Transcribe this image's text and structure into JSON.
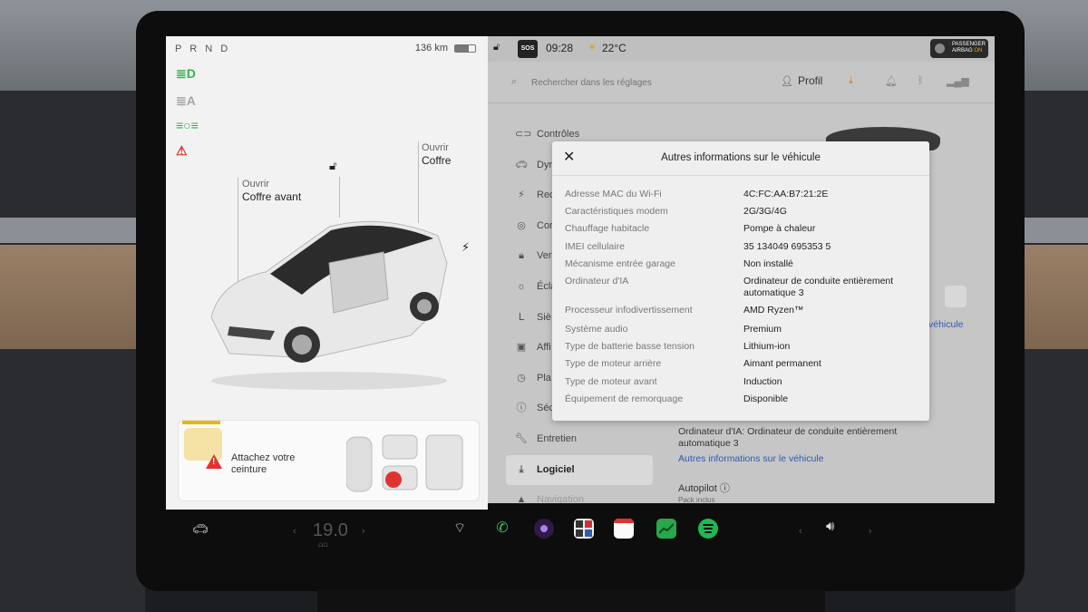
{
  "car": {
    "gear": "P R N D",
    "range": "136 km",
    "open_label_1": "Ouvrir",
    "coffre_avant": "Coffre avant",
    "open_label_2": "Ouvrir",
    "coffre": "Coffre",
    "belt_warning": "Attachez votre ceinture"
  },
  "status": {
    "sos": "SOS",
    "time": "09:28",
    "temperature": "22°C",
    "airbag_line1": "PASSENGER",
    "airbag_line2": "AIRBAG",
    "airbag_state": "ON"
  },
  "search": {
    "placeholder": "Rechercher dans les réglages",
    "profile": "Profil"
  },
  "menu": [
    {
      "label": "Contrôles",
      "icon": "toggle-icon"
    },
    {
      "label": "Dyn",
      "icon": "car-icon"
    },
    {
      "label": "Rec",
      "icon": "bolt-icon"
    },
    {
      "label": "Con",
      "icon": "steering-wheel-icon"
    },
    {
      "label": "Ver",
      "icon": "lock-icon"
    },
    {
      "label": "Écla",
      "icon": "light-icon"
    },
    {
      "label": "Siè",
      "icon": "seat-icon"
    },
    {
      "label": "Affi",
      "icon": "display-icon"
    },
    {
      "label": "Pla",
      "icon": "clock-icon"
    },
    {
      "label": "Séc",
      "icon": "info-icon"
    },
    {
      "label": "Entretien",
      "icon": "wrench-icon"
    },
    {
      "label": "Logiciel",
      "icon": "download-icon",
      "active": true
    },
    {
      "label": "Navigation",
      "icon": "navigation-icon"
    }
  ],
  "details": {
    "ai_computer": "Ordinateur d'IA: Ordinateur de conduite entièrement automatique 3",
    "more_info_link": "Autres informations sur le véhicule",
    "autopilot": "Autopilot",
    "pack": "Pack inclus",
    "side_link": "véhicule"
  },
  "modal": {
    "title": "Autres informations sur le véhicule",
    "rows": [
      {
        "label": "Adresse MAC du Wi-Fi",
        "value": "4C:FC:AA:B7:21:2E"
      },
      {
        "label": "Caractéristiques modem",
        "value": "2G/3G/4G"
      },
      {
        "label": "Chauffage habitacle",
        "value": "Pompe à chaleur"
      },
      {
        "label": "IMEI cellulaire",
        "value": "35 134049 695353 5"
      },
      {
        "label": "Mécanisme entrée garage",
        "value": "Non installé"
      },
      {
        "label": "Ordinateur d'IA",
        "value": "Ordinateur de conduite entièrement automatique 3"
      },
      {
        "label": "Processeur infodivertissement",
        "value": "AMD Ryzen™"
      },
      {
        "label": "Système audio",
        "value": "Premium"
      },
      {
        "label": "Type de batterie basse tension",
        "value": "Lithium-ion"
      },
      {
        "label": "Type de moteur arrière",
        "value": "Aimant permanent"
      },
      {
        "label": "Type de moteur avant",
        "value": "Induction"
      },
      {
        "label": "Équipement de remorquage",
        "value": "Disponible"
      }
    ]
  },
  "taskbar": {
    "temp_setting": "19.0",
    "seat_heat_icon": "seat-heater-icon"
  },
  "colors": {
    "link": "#2e5ab4",
    "warning": "#e0332f",
    "indicator_green": "#32b34a",
    "download_orange": "#e07020"
  }
}
